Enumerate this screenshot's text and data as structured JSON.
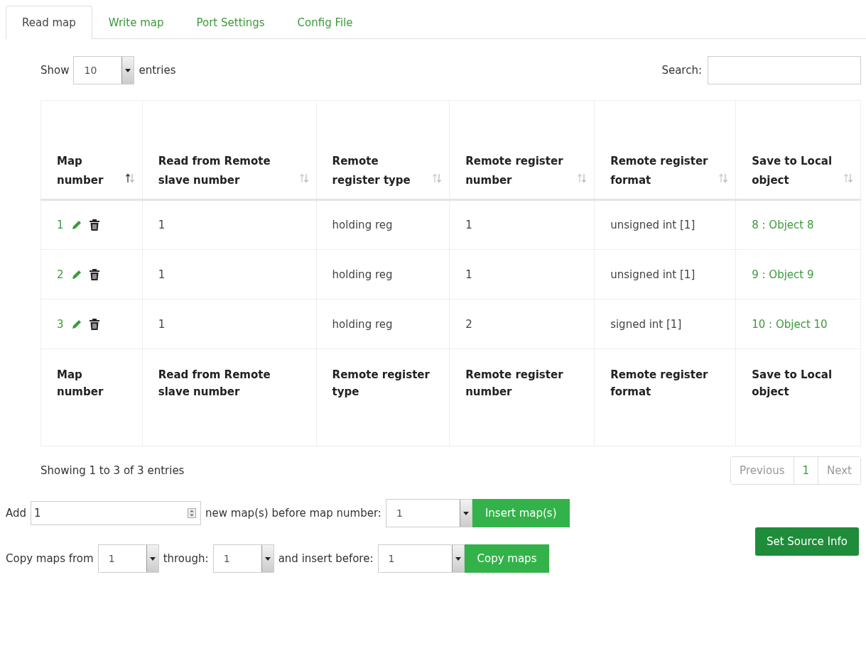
{
  "tabs": [
    {
      "label": "Read map",
      "selected": true
    },
    {
      "label": "Write map",
      "selected": false
    },
    {
      "label": "Port Settings",
      "selected": false
    },
    {
      "label": "Config File",
      "selected": false
    }
  ],
  "length": {
    "label_before": "Show",
    "value": "10",
    "label_after": "entries"
  },
  "search": {
    "label": "Search:"
  },
  "table": {
    "columns": [
      {
        "label": "Map number",
        "sorted": true
      },
      {
        "label": "Read from Remote slave number",
        "sorted": false
      },
      {
        "label": "Remote register type",
        "sorted": false
      },
      {
        "label": "Remote register number",
        "sorted": false
      },
      {
        "label": "Remote register format",
        "sorted": false
      },
      {
        "label": "Save to Local object",
        "sorted": false
      }
    ],
    "rows": [
      {
        "cells": [
          "1",
          "1",
          "holding reg",
          "1",
          "unsigned int [1]",
          "8 : Object 8"
        ]
      },
      {
        "cells": [
          "2",
          "1",
          "holding reg",
          "1",
          "unsigned int [1]",
          "9 : Object 9"
        ]
      },
      {
        "cells": [
          "3",
          "1",
          "holding reg",
          "2",
          "signed int [1]",
          "10 : Object 10"
        ]
      }
    ],
    "footer": [
      "Map number",
      "Read from Remote slave number",
      "Remote register type",
      "Remote register number",
      "Remote register format",
      "Save to Local object"
    ]
  },
  "info": "Showing 1 to 3 of 3 entries",
  "pagination": {
    "previous": {
      "label": "Previous",
      "disabled": true
    },
    "pages": [
      {
        "label": "1",
        "selected": true
      }
    ],
    "next": {
      "label": "Next",
      "disabled": true
    }
  },
  "add_row": {
    "label": "Add",
    "count": "1",
    "text": "new map(s) before map number:",
    "before": "1",
    "button": "Insert map(s)"
  },
  "copy_row": {
    "label": "Copy maps from",
    "from": "1",
    "through_label": "through:",
    "through": "1",
    "insert_label": "and insert before:",
    "before": "1",
    "button": "Copy maps"
  },
  "source_button": "Set Source Info"
}
